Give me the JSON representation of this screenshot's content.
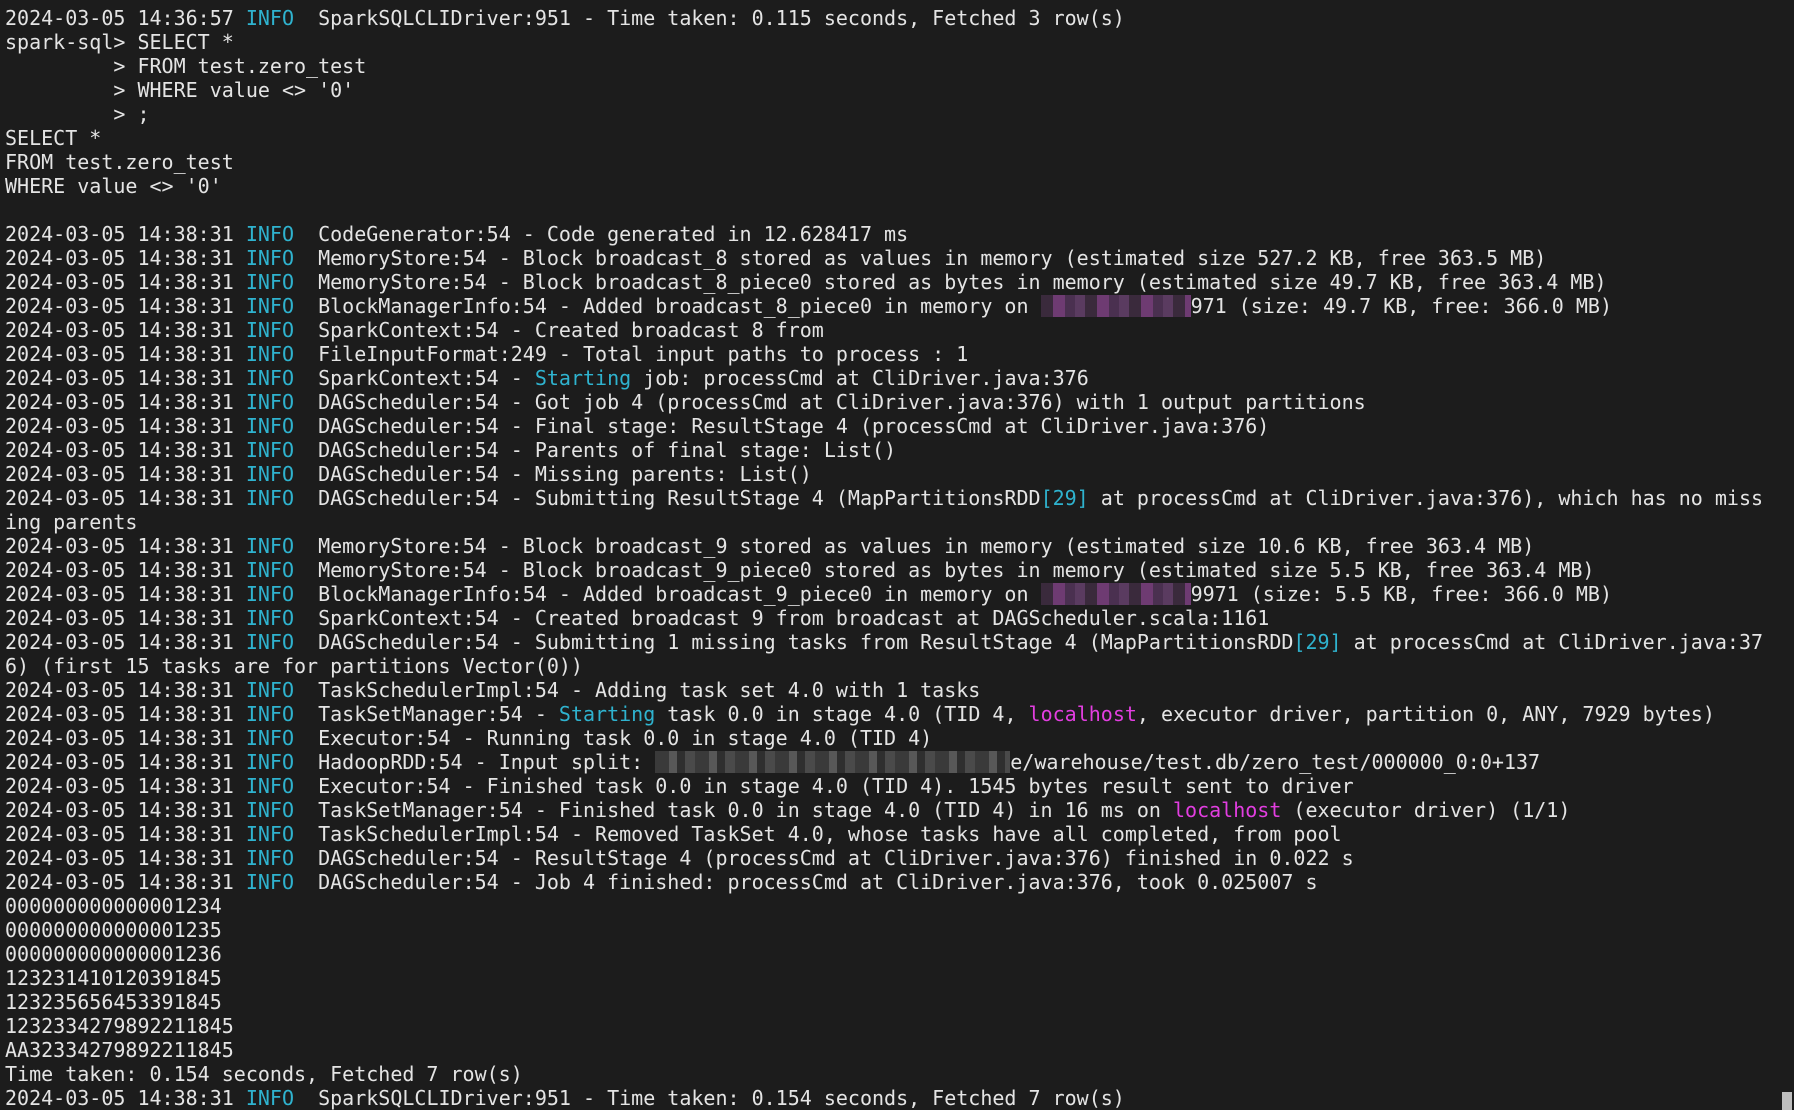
{
  "terminal": {
    "lines": [
      {
        "ts": "2024-03-05 14:36:57",
        "level": "INFO",
        "msg": "SparkSQLCLIDriver:951 - Time taken: 0.115 seconds, Fetched 3 row(s)"
      },
      {
        "text": "spark-sql> SELECT *"
      },
      {
        "text": "         > FROM test.zero_test"
      },
      {
        "text": "         > WHERE value <> '0'"
      },
      {
        "text": "         > ;"
      },
      {
        "text": "SELECT *"
      },
      {
        "text": "FROM test.zero_test"
      },
      {
        "text": "WHERE value <> '0'"
      },
      {
        "text": ""
      },
      {
        "ts": "2024-03-05 14:38:31",
        "level": "INFO",
        "msg": "CodeGenerator:54 - Code generated in 12.628417 ms"
      },
      {
        "ts": "2024-03-05 14:38:31",
        "level": "INFO",
        "msg": "MemoryStore:54 - Block broadcast_8 stored as values in memory (estimated size 527.2 KB, free 363.5 MB)"
      },
      {
        "ts": "2024-03-05 14:38:31",
        "level": "INFO",
        "msg": "MemoryStore:54 - Block broadcast_8_piece0 stored as bytes in memory (estimated size 49.7 KB, free 363.4 MB)"
      },
      {
        "ts": "2024-03-05 14:38:31",
        "level": "INFO",
        "parts": [
          {
            "t": "BlockManagerInfo:54 - Added broadcast_8_piece0 in memory on "
          },
          {
            "redact": "purple",
            "w": 150
          },
          {
            "t": "971 (size: 49.7 KB, free: 366.0 MB)"
          }
        ]
      },
      {
        "ts": "2024-03-05 14:38:31",
        "level": "INFO",
        "msg": "SparkContext:54 - Created broadcast 8 from"
      },
      {
        "ts": "2024-03-05 14:38:31",
        "level": "INFO",
        "msg": "FileInputFormat:249 - Total input paths to process : 1"
      },
      {
        "ts": "2024-03-05 14:38:31",
        "level": "INFO",
        "parts": [
          {
            "t": "SparkContext:54 - "
          },
          {
            "t": "Starting",
            "c": "cyan"
          },
          {
            "t": " job: processCmd at CliDriver.java:376"
          }
        ]
      },
      {
        "ts": "2024-03-05 14:38:31",
        "level": "INFO",
        "msg": "DAGScheduler:54 - Got job 4 (processCmd at CliDriver.java:376) with 1 output partitions"
      },
      {
        "ts": "2024-03-05 14:38:31",
        "level": "INFO",
        "msg": "DAGScheduler:54 - Final stage: ResultStage 4 (processCmd at CliDriver.java:376)"
      },
      {
        "ts": "2024-03-05 14:38:31",
        "level": "INFO",
        "msg": "DAGScheduler:54 - Parents of final stage: List()"
      },
      {
        "ts": "2024-03-05 14:38:31",
        "level": "INFO",
        "msg": "DAGScheduler:54 - Missing parents: List()"
      },
      {
        "ts": "2024-03-05 14:38:31",
        "level": "INFO",
        "parts": [
          {
            "t": "DAGScheduler:54 - Submitting ResultStage 4 (MapPartitionsRDD"
          },
          {
            "t": "[29]",
            "c": "cyan"
          },
          {
            "t": " at processCmd at CliDriver.java:376), which has no miss"
          }
        ]
      },
      {
        "text": "ing parents"
      },
      {
        "ts": "2024-03-05 14:38:31",
        "level": "INFO",
        "msg": "MemoryStore:54 - Block broadcast_9 stored as values in memory (estimated size 10.6 KB, free 363.4 MB)"
      },
      {
        "ts": "2024-03-05 14:38:31",
        "level": "INFO",
        "msg": "MemoryStore:54 - Block broadcast_9_piece0 stored as bytes in memory (estimated size 5.5 KB, free 363.4 MB)"
      },
      {
        "ts": "2024-03-05 14:38:31",
        "level": "INFO",
        "parts": [
          {
            "t": "BlockManagerInfo:54 - Added broadcast_9_piece0 in memory on "
          },
          {
            "redact": "purple",
            "w": 150
          },
          {
            "t": "9971 (size: 5.5 KB, free: 366.0 MB)"
          }
        ]
      },
      {
        "ts": "2024-03-05 14:38:31",
        "level": "INFO",
        "msg": "SparkContext:54 - Created broadcast 9 from broadcast at DAGScheduler.scala:1161"
      },
      {
        "ts": "2024-03-05 14:38:31",
        "level": "INFO",
        "parts": [
          {
            "t": "DAGScheduler:54 - Submitting 1 missing tasks from ResultStage 4 (MapPartitionsRDD"
          },
          {
            "t": "[29]",
            "c": "cyan"
          },
          {
            "t": " at processCmd at CliDriver.java:37"
          }
        ]
      },
      {
        "text": "6) (first 15 tasks are for partitions Vector(0))"
      },
      {
        "ts": "2024-03-05 14:38:31",
        "level": "INFO",
        "msg": "TaskSchedulerImpl:54 - Adding task set 4.0 with 1 tasks"
      },
      {
        "ts": "2024-03-05 14:38:31",
        "level": "INFO",
        "parts": [
          {
            "t": "TaskSetManager:54 - "
          },
          {
            "t": "Starting",
            "c": "cyan"
          },
          {
            "t": " task 0.0 in stage 4.0 (TID 4, "
          },
          {
            "t": "localhost",
            "c": "magenta"
          },
          {
            "t": ", executor driver, partition 0, ANY, 7929 bytes)"
          }
        ]
      },
      {
        "ts": "2024-03-05 14:38:31",
        "level": "INFO",
        "msg": "Executor:54 - Running task 0.0 in stage 4.0 (TID 4)"
      },
      {
        "ts": "2024-03-05 14:38:31",
        "level": "INFO",
        "parts": [
          {
            "t": "HadoopRDD:54 - Input split: "
          },
          {
            "redact": "gray",
            "w": 355
          },
          {
            "t": "e/warehouse/test.db/zero_test/000000_0:0+137"
          }
        ]
      },
      {
        "ts": "2024-03-05 14:38:31",
        "level": "INFO",
        "msg": "Executor:54 - Finished task 0.0 in stage 4.0 (TID 4). 1545 bytes result sent to driver"
      },
      {
        "ts": "2024-03-05 14:38:31",
        "level": "INFO",
        "parts": [
          {
            "t": "TaskSetManager:54 - Finished task 0.0 in stage 4.0 (TID 4) in 16 ms on "
          },
          {
            "t": "localhost",
            "c": "magenta"
          },
          {
            "t": " (executor driver) (1/1)"
          }
        ]
      },
      {
        "ts": "2024-03-05 14:38:31",
        "level": "INFO",
        "msg": "TaskSchedulerImpl:54 - Removed TaskSet 4.0, whose tasks have all completed, from pool"
      },
      {
        "ts": "2024-03-05 14:38:31",
        "level": "INFO",
        "msg": "DAGScheduler:54 - ResultStage 4 (processCmd at CliDriver.java:376) finished in 0.022 s"
      },
      {
        "ts": "2024-03-05 14:38:31",
        "level": "INFO",
        "msg": "DAGScheduler:54 - Job 4 finished: processCmd at CliDriver.java:376, took 0.025007 s"
      },
      {
        "text": "000000000000001234"
      },
      {
        "text": "000000000000001235"
      },
      {
        "text": "000000000000001236"
      },
      {
        "text": "123231410120391845"
      },
      {
        "text": "123235656453391845"
      },
      {
        "text": "1232334279892211845"
      },
      {
        "text": "AA32334279892211845"
      },
      {
        "text": "Time taken: 0.154 seconds, Fetched 7 row(s)"
      },
      {
        "ts": "2024-03-05 14:38:31",
        "level": "INFO",
        "msg": "SparkSQLCLIDriver:951 - Time taken: 0.154 seconds, Fetched 7 row(s)"
      }
    ]
  },
  "colors": {
    "background": "#1c1c1c",
    "text": "#e4e4e4",
    "info": "#2fb3cf",
    "highlight_cyan": "#2fb3cf",
    "highlight_magenta": "#e23ee0"
  }
}
